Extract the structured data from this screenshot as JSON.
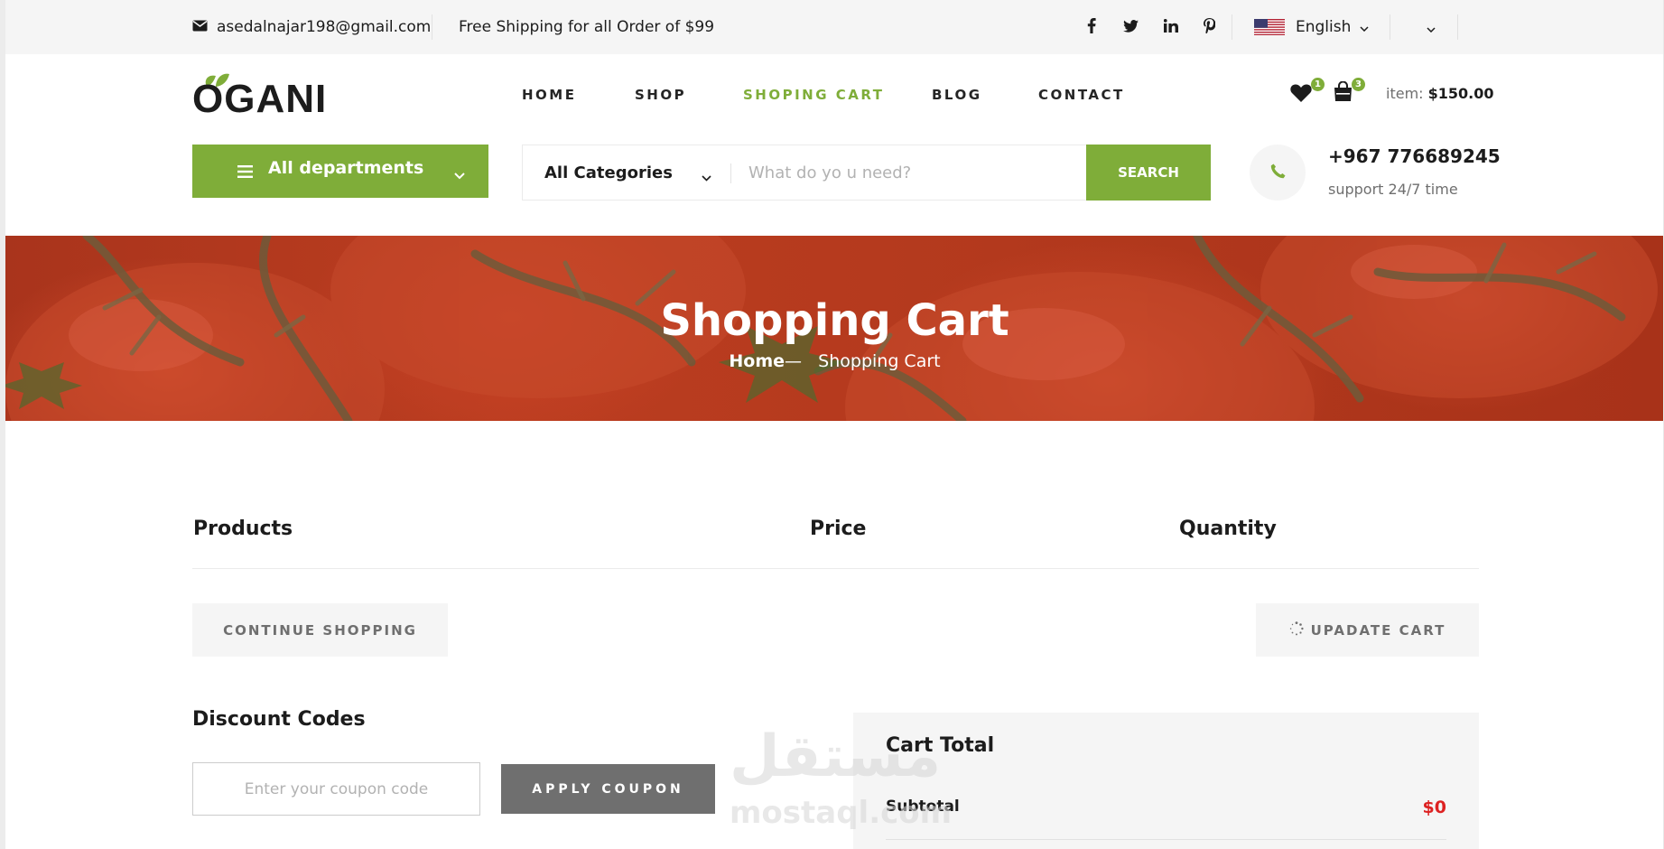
{
  "topbar": {
    "email": "asedalnajar198@gmail.com",
    "shipping_note": "Free Shipping for all Order of $99",
    "social": [
      "facebook-icon",
      "twitter-icon",
      "linkedin-icon",
      "pinterest-icon"
    ],
    "language": "English"
  },
  "header": {
    "logo_text": "OGANI",
    "nav": [
      {
        "label": "HOME",
        "active": false
      },
      {
        "label": "SHOP",
        "active": false
      },
      {
        "label": "SHOPING CART",
        "active": true
      },
      {
        "label": "BLOG",
        "active": false
      },
      {
        "label": "CONTACT",
        "active": false
      }
    ],
    "wishlist_count": "1",
    "cart_count": "3",
    "item_label": "item:",
    "item_total": "$150.00"
  },
  "toolbar": {
    "departments_label": "All departments",
    "category_label": "All Categories",
    "search_placeholder": "What do yo u need?",
    "search_button": "SEARCH",
    "phone": "+967 776689245",
    "phone_sub": "support 24/7 time"
  },
  "hero": {
    "title": "Shopping Cart",
    "crumb_home": "Home",
    "crumb_sep": "—",
    "crumb_current": "Shopping Cart"
  },
  "cart": {
    "columns": [
      "Products",
      "Price",
      "Quantity"
    ],
    "continue_label": "CONTINUE SHOPPING",
    "update_label": "UPADATE CART"
  },
  "discount": {
    "title": "Discount Codes",
    "placeholder": "Enter your coupon code",
    "apply_label": "APPLY COUPON"
  },
  "totals": {
    "title": "Cart Total",
    "subtotal_label": "Subtotal",
    "subtotal_value": "$0"
  },
  "watermark": {
    "arabic": "مستقل",
    "latin": "mostaql.com"
  },
  "colors": {
    "accent": "#7fad39",
    "price_red": "#dd2222",
    "muted_grey": "#6f6f6f",
    "panel_bg": "#f5f5f5"
  }
}
